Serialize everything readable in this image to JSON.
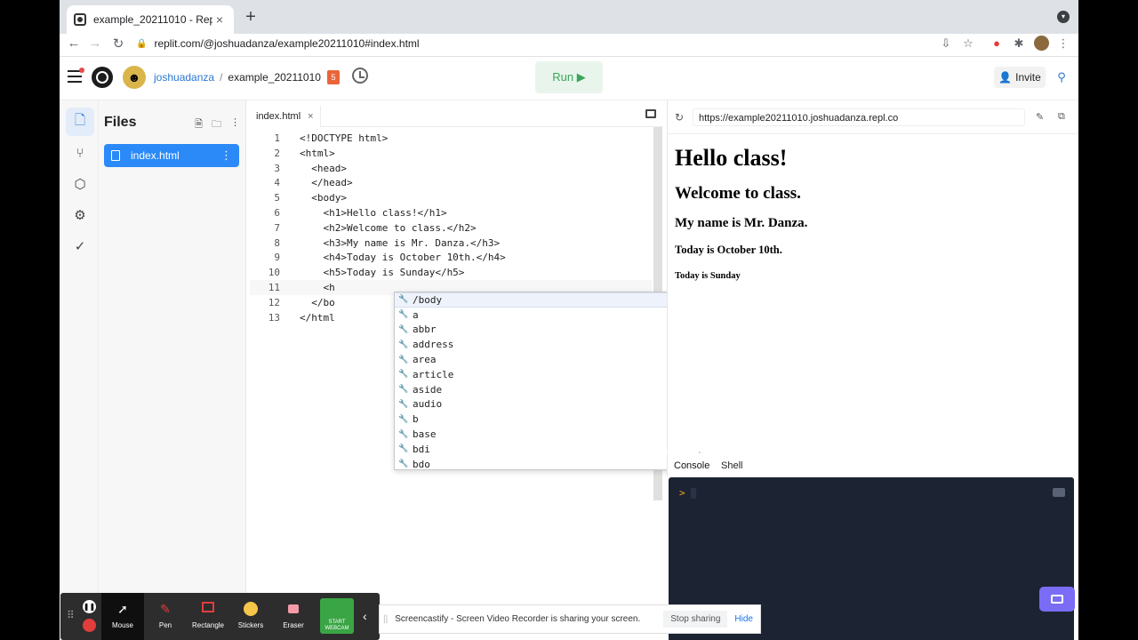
{
  "browser": {
    "tab_title": "example_20211010 - Replit",
    "tab_close": "×",
    "new_tab": "+",
    "url": "replit.com/@joshuadanza/example20211010#index.html"
  },
  "header": {
    "user": "joshuadanza",
    "separator": "/",
    "repl_name": "example_20211010",
    "run_label": "Run ▶",
    "invite_label": "Invite"
  },
  "files": {
    "title": "Files",
    "items": [
      {
        "name": "index.html"
      }
    ]
  },
  "editor": {
    "tab_label": "index.html",
    "tab_close": "×",
    "lines": [
      "<!DOCTYPE html>",
      "<html>",
      "  <head>",
      "  </head>",
      "  <body>",
      "    <h1>Hello class!</h1>",
      "    <h2>Welcome to class.</h2>",
      "    <h3>My name is Mr. Danza.</h3>",
      "    <h4>Today is October 10th.</h4>",
      "    <h5>Today is Sunday</h5>",
      "    <h",
      "  </bo",
      "</html"
    ],
    "autocomplete": [
      "/body",
      "a",
      "abbr",
      "address",
      "area",
      "article",
      "aside",
      "audio",
      "b",
      "base",
      "bdi",
      "bdo"
    ]
  },
  "preview": {
    "url": "https://example20211010.joshuadanza.repl.co",
    "h1": "Hello class!",
    "h2": "Welcome to class.",
    "h3": "My name is Mr. Danza.",
    "h4": "Today is October 10th.",
    "h5": "Today is Sunday"
  },
  "console": {
    "tabs": [
      "Console",
      "Shell"
    ],
    "prompt": ">"
  },
  "screencastify": {
    "tools": [
      "Mouse",
      "Pen",
      "Rectangle",
      "Stickers",
      "Eraser"
    ],
    "webcam_label": "START WEBCAM",
    "share_message": "Screencastify - Screen Video Recorder is sharing your screen.",
    "stop_label": "Stop sharing",
    "hide_label": "Hide"
  },
  "colors": {
    "accent_blue": "#2b8af7",
    "run_green": "#3aa55a",
    "console_bg": "#1c2333",
    "chat_purple": "#7b6cf6"
  }
}
